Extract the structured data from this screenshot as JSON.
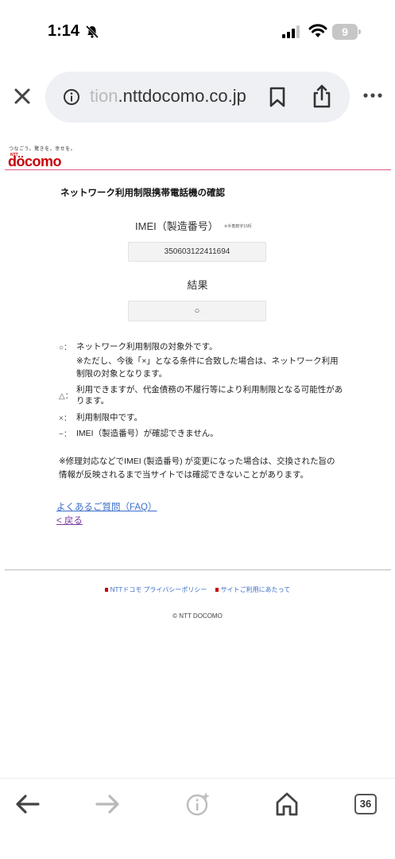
{
  "status_bar": {
    "time": "1:14",
    "battery": "9"
  },
  "browser": {
    "url_faded": "tion",
    "url_main": ".nttdocomo.co.jp"
  },
  "header": {
    "tagline": "つなごう。驚きを。幸せを。",
    "logo_ntt": "NTT",
    "logo": "döcomo"
  },
  "page": {
    "title": "ネットワーク利用制限携帯電話機の確認",
    "imei_label": "IMEI（製造番号）",
    "imei_note": "※半角数字15桁",
    "imei_value": "350603122411694",
    "result_label": "結果",
    "result_value": "○"
  },
  "legend": {
    "item1_symbol": "○：",
    "item1_text": "ネットワーク利用制限の対象外です。",
    "item1_note": "※ただし、今後「×」となる条件に合致した場合は、ネットワーク利用制限の対象となります。",
    "item2_symbol": "△：",
    "item2_text": "利用できますが、代金債務の不履行等により利用制限となる可能性があります。",
    "item3_symbol": "×：",
    "item3_text": "利用制限中です。",
    "item4_symbol": "−：",
    "item4_text": "IMEI（製造番号）が確認できません。"
  },
  "notice": "※修理対応などでIMEI (製造番号) が変更になった場合は、交換された旨の情報が反映されるまで当サイトでは確認できないことがあります。",
  "links": {
    "faq": "よくあるご質問（FAQ）",
    "back": "< 戻る"
  },
  "footer": {
    "privacy": "NTTドコモ プライバシーポリシー",
    "terms": "サイトご利用にあたって",
    "copyright": "© NTT DOCOMO"
  },
  "toolbar": {
    "tab_count": "36"
  },
  "colors": {
    "brand": "#c7000b",
    "link": "#3b6ec8",
    "visited": "#7a3aa0"
  }
}
